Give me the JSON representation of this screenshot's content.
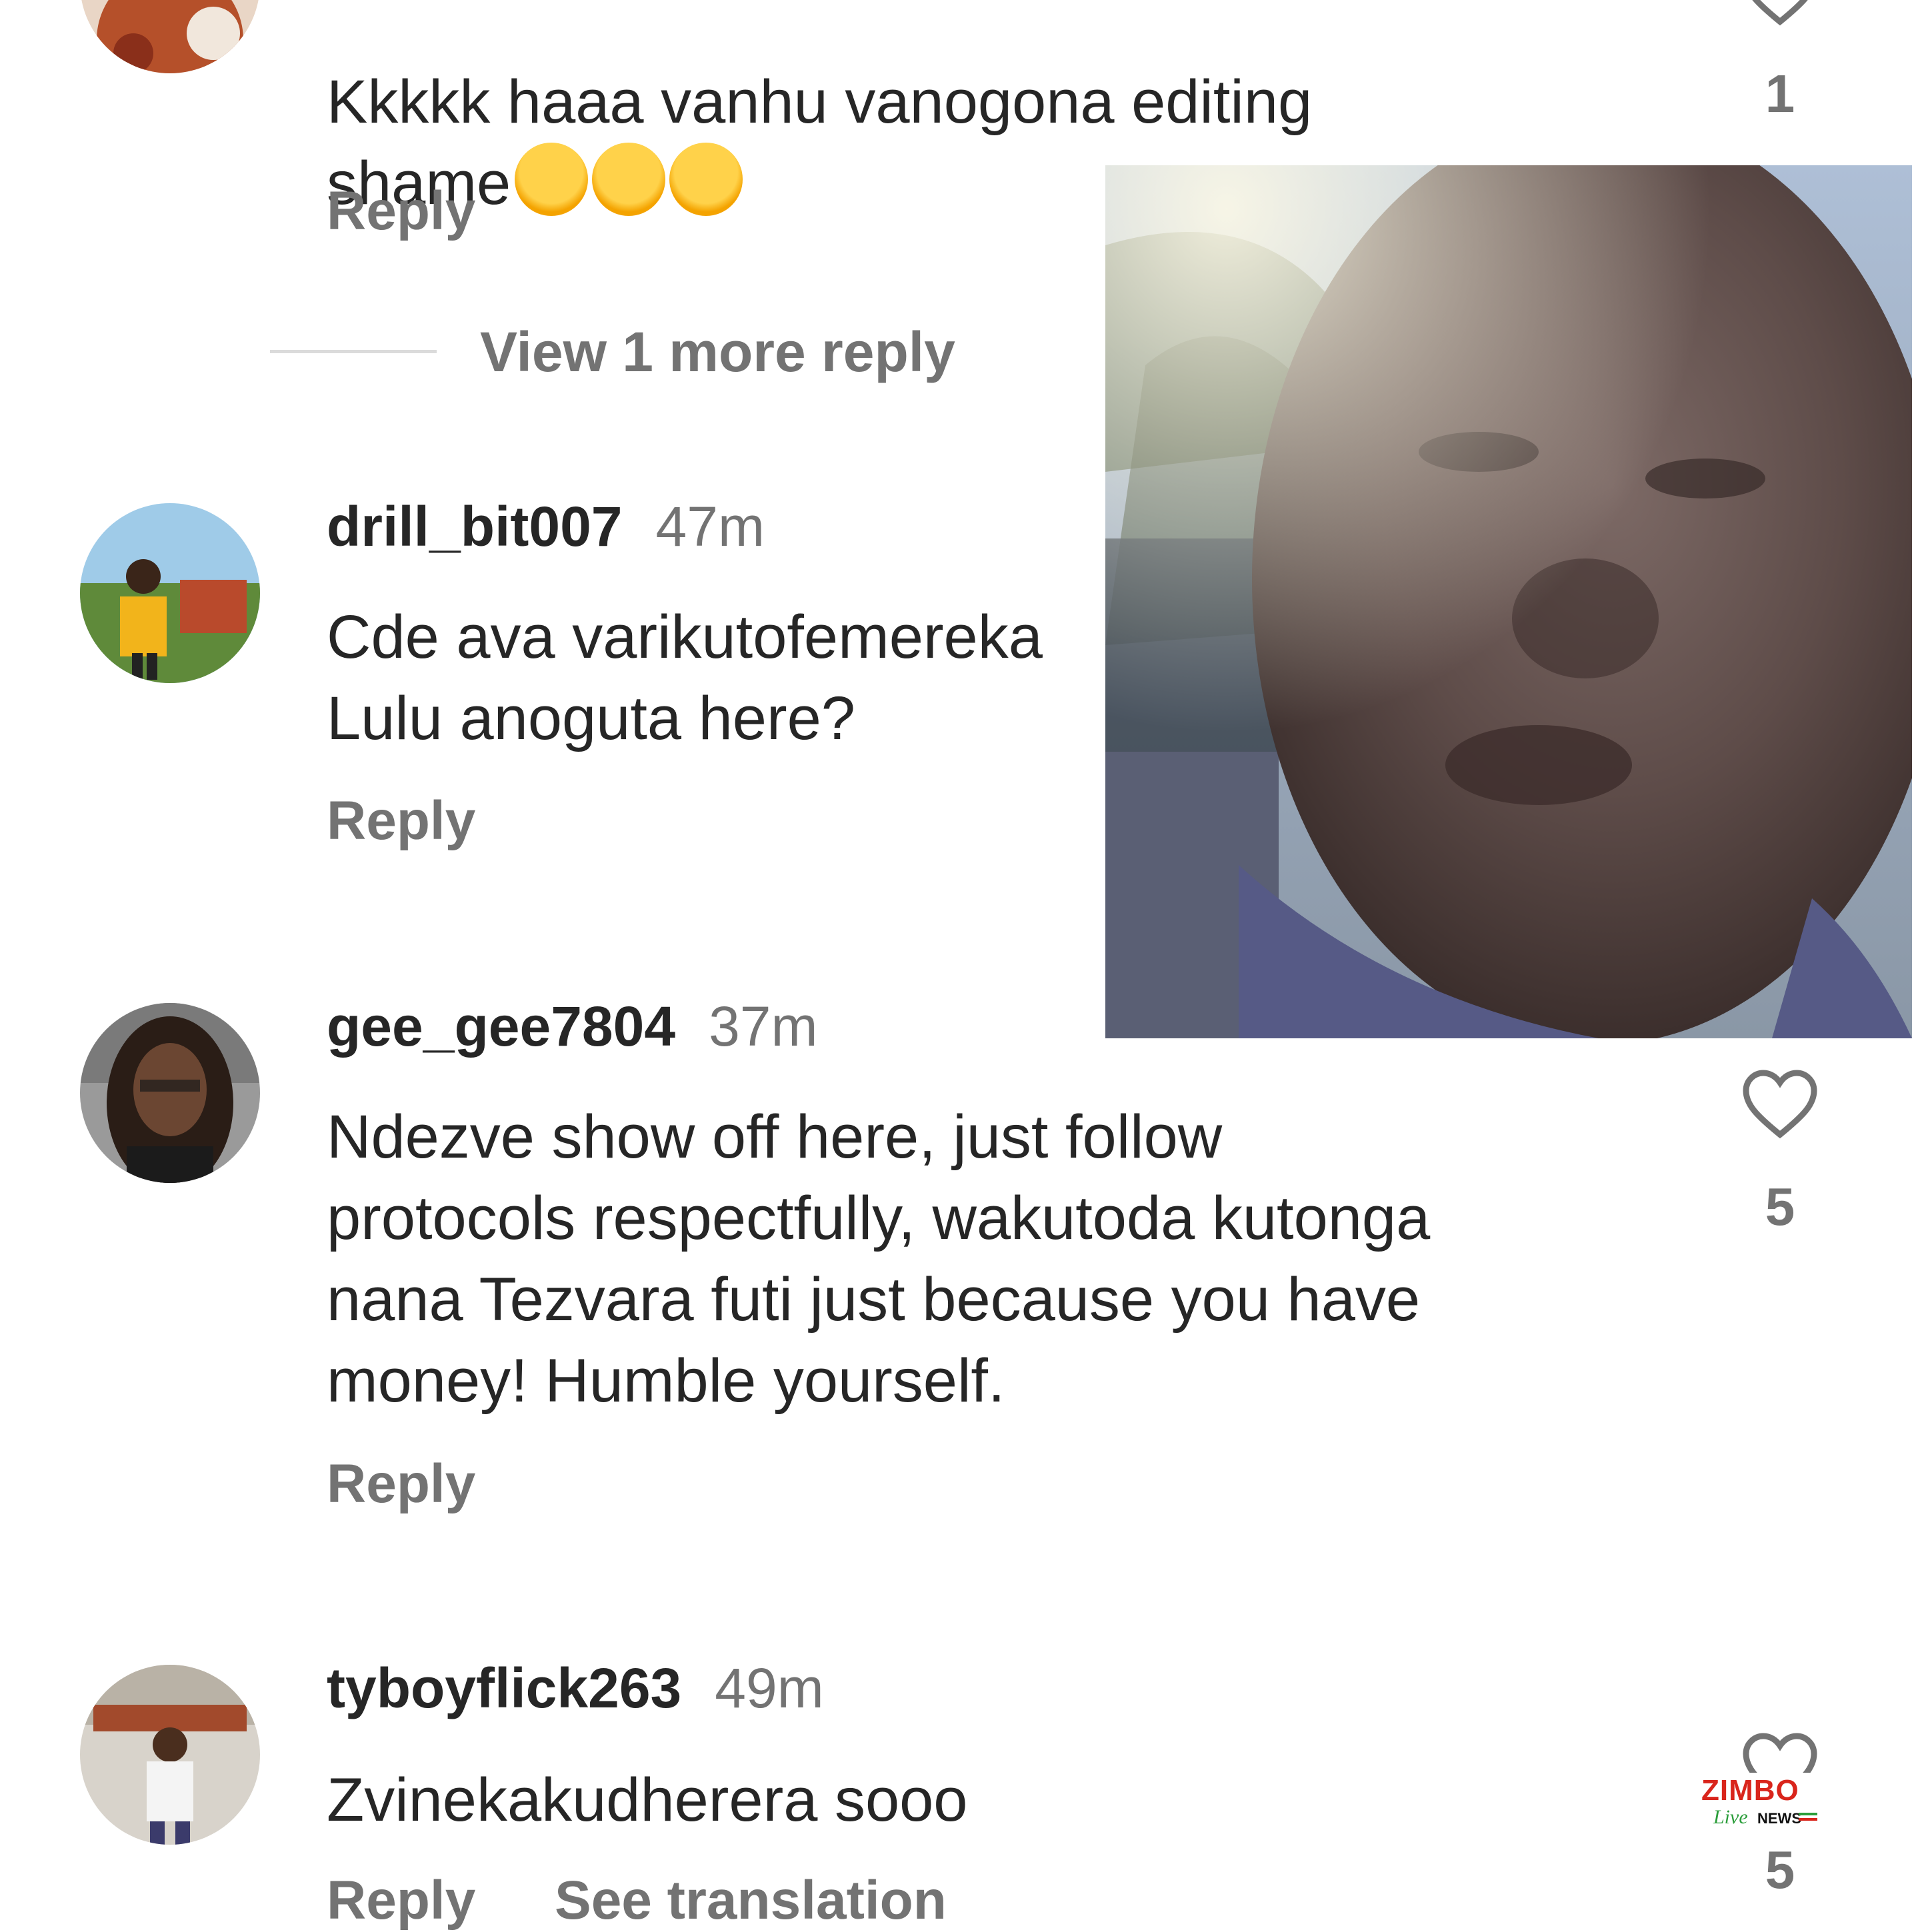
{
  "colors": {
    "text": "#262626",
    "muted": "#737373",
    "divider": "#dbdbdb",
    "brand_red": "#d9251c",
    "brand_green": "#2a9d3a"
  },
  "comments": [
    {
      "username": "",
      "time": "",
      "text": "Kkkkk haaa vanhu vanogona editing\nshame",
      "emoji": [
        "face-with-tears-of-joy",
        "face-with-tears-of-joy",
        "face-with-tears-of-joy"
      ],
      "reply_label": "Reply",
      "likes": "1",
      "view_more": "View 1 more reply"
    },
    {
      "username": "drill_bit007",
      "time": "47m",
      "text": "Cde ava varikutofemereka\nLulu anoguta here?",
      "reply_label": "Reply"
    },
    {
      "username": "gee_gee7804",
      "time": "37m",
      "text": "Ndezve show off here, just follow\nprotocols respectfully, wakutoda kutonga\nnana Tezvara futi just because you have\nmoney! Humble yourself.",
      "reply_label": "Reply",
      "likes": "5"
    },
    {
      "username": "tyboyflick263",
      "time": "49m",
      "text": "Zvinekakudherera sooo",
      "reply_label": "Reply",
      "translation_label": "See translation",
      "likes": "5"
    }
  ],
  "watermark": {
    "brand": "ZIMBO",
    "sub_script": "Live",
    "sub_caps": "NEWS"
  },
  "icons": [
    "heart-outline-icon",
    "face-with-tears-of-joy-icon"
  ]
}
